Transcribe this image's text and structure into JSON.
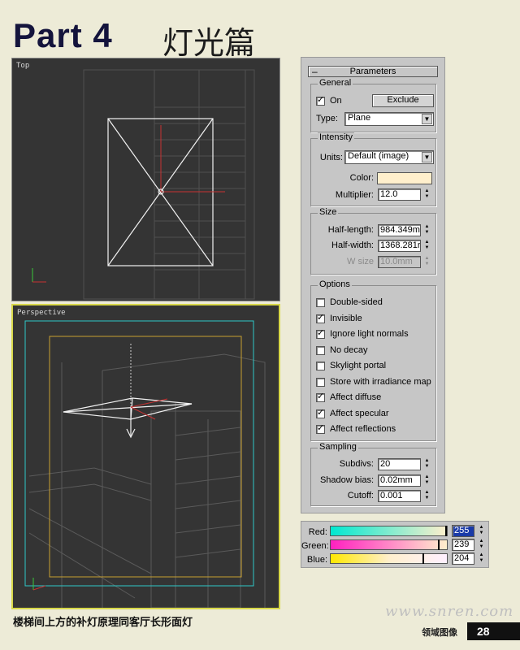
{
  "header": {
    "part": "Part 4",
    "title_cn": "灯光篇"
  },
  "viewports": {
    "top_label": "Top",
    "perspective_label": "Perspective"
  },
  "panel": {
    "rollout_title": "Parameters",
    "general": {
      "title": "General",
      "on_label": "On",
      "on_checked": true,
      "exclude_label": "Exclude",
      "type_label": "Type:",
      "type_value": "Plane"
    },
    "intensity": {
      "title": "Intensity",
      "units_label": "Units:",
      "units_value": "Default (image)",
      "color_label": "Color:",
      "color_value": "#ffefcc",
      "multiplier_label": "Multiplier:",
      "multiplier_value": "12.0"
    },
    "size": {
      "title": "Size",
      "half_length_label": "Half-length:",
      "half_length_value": "984.349m",
      "half_width_label": "Half-width:",
      "half_width_value": "1368.281r",
      "w_size_label": "W size",
      "w_size_value": "10.0mm"
    },
    "options": {
      "title": "Options",
      "items": [
        {
          "label": "Double-sided",
          "checked": false
        },
        {
          "label": "Invisible",
          "checked": true
        },
        {
          "label": "Ignore light normals",
          "checked": true
        },
        {
          "label": "No decay",
          "checked": false
        },
        {
          "label": "Skylight portal",
          "checked": false
        },
        {
          "label": "Store with irradiance map",
          "checked": false
        },
        {
          "label": "Affect diffuse",
          "checked": true
        },
        {
          "label": "Affect specular",
          "checked": true
        },
        {
          "label": "Affect reflections",
          "checked": true
        }
      ]
    },
    "sampling": {
      "title": "Sampling",
      "subdivs_label": "Subdivs:",
      "subdivs_value": "20",
      "shadow_bias_label": "Shadow bias:",
      "shadow_bias_value": "0.02mm",
      "cutoff_label": "Cutoff:",
      "cutoff_value": "0.001"
    }
  },
  "rgb": {
    "red_label": "Red:",
    "red_value": "255",
    "red_level": 1.0,
    "green_label": "Green:",
    "green_value": "239",
    "green_level": 0.937,
    "blue_label": "Blue:",
    "blue_value": "204",
    "blue_level": 0.8
  },
  "caption": "楼梯间上方的补灯原理同客厅长形面灯",
  "footer": {
    "site": "www.snren.com",
    "label": "领域图像",
    "page": "28"
  }
}
